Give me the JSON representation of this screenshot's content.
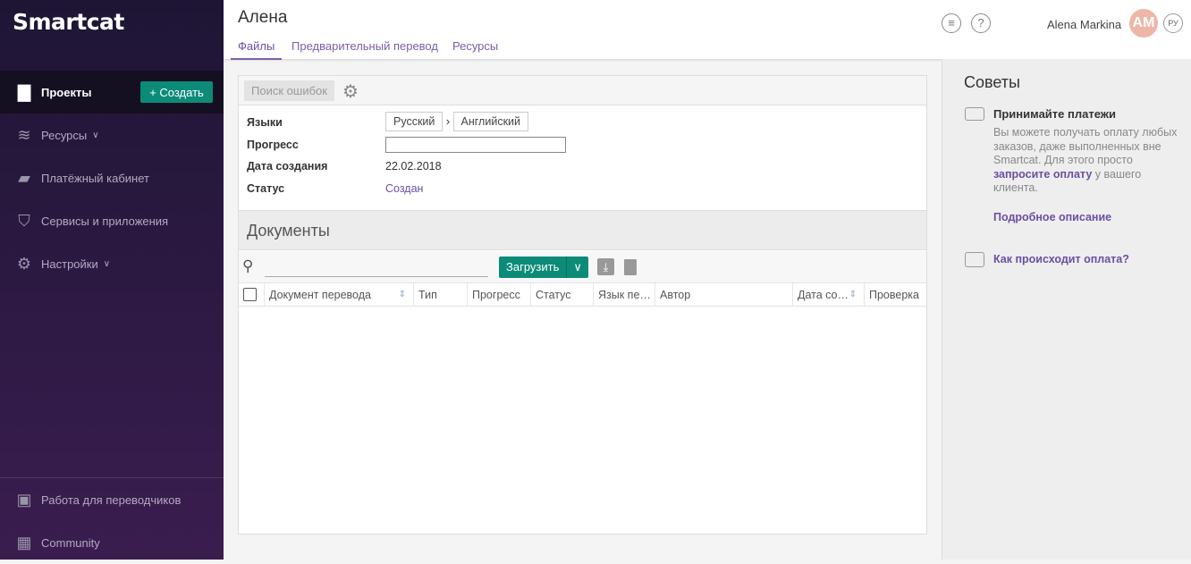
{
  "sidebar": {
    "logo": "Smartcat",
    "create": "+ Создать",
    "items": [
      {
        "label": "Проекты",
        "icon": "folder-icon"
      },
      {
        "label": "Ресурсы",
        "icon": "layers-icon"
      },
      {
        "label": "Платёжный кабинет",
        "icon": "wallet-icon"
      },
      {
        "label": "Сервисы и приложения",
        "icon": "basket-icon"
      },
      {
        "label": "Настройки",
        "icon": "gear-icon"
      }
    ],
    "bottom": [
      {
        "label": "Работа для переводчиков",
        "icon": "badge-icon"
      },
      {
        "label": "Community",
        "icon": "calendar-icon"
      }
    ]
  },
  "header": {
    "title": "Алена",
    "tabs": [
      "Файлы",
      "Предварительный перевод",
      "Ресурсы"
    ],
    "user": "Alena Markina",
    "avatar": "AM",
    "lang": "РУ"
  },
  "project": {
    "error_search": "Поиск ошибок",
    "fields": {
      "languages": "Языки",
      "progress": "Прогресс",
      "created": "Дата создания",
      "status": "Статус"
    },
    "source_lang": "Русский",
    "target_lang": "Английский",
    "progress_value": 0,
    "created_date": "22.02.2018",
    "status_value": "Создан"
  },
  "documents": {
    "title": "Документы",
    "upload": "Загрузить",
    "columns": [
      "Документ перевода",
      "Тип",
      "Прогресс",
      "Статус",
      "Язык пе…",
      "Автор",
      "Дата со…",
      "Проверка"
    ]
  },
  "tips": {
    "title": "Советы",
    "payments_title": "Принимайте платежи",
    "payments_text": "Вы можете получать оплату любых заказов, даже выполненных вне Smartcat. Для этого просто",
    "payments_link": "запросите оплату",
    "payments_tail": " у вашего клиента.",
    "details": "Подробное описание",
    "how": "Как происходит оплата?"
  },
  "colors": {
    "accent": "#0c8b78",
    "link": "#6b4fa3",
    "sidebar": "#261a3d"
  }
}
